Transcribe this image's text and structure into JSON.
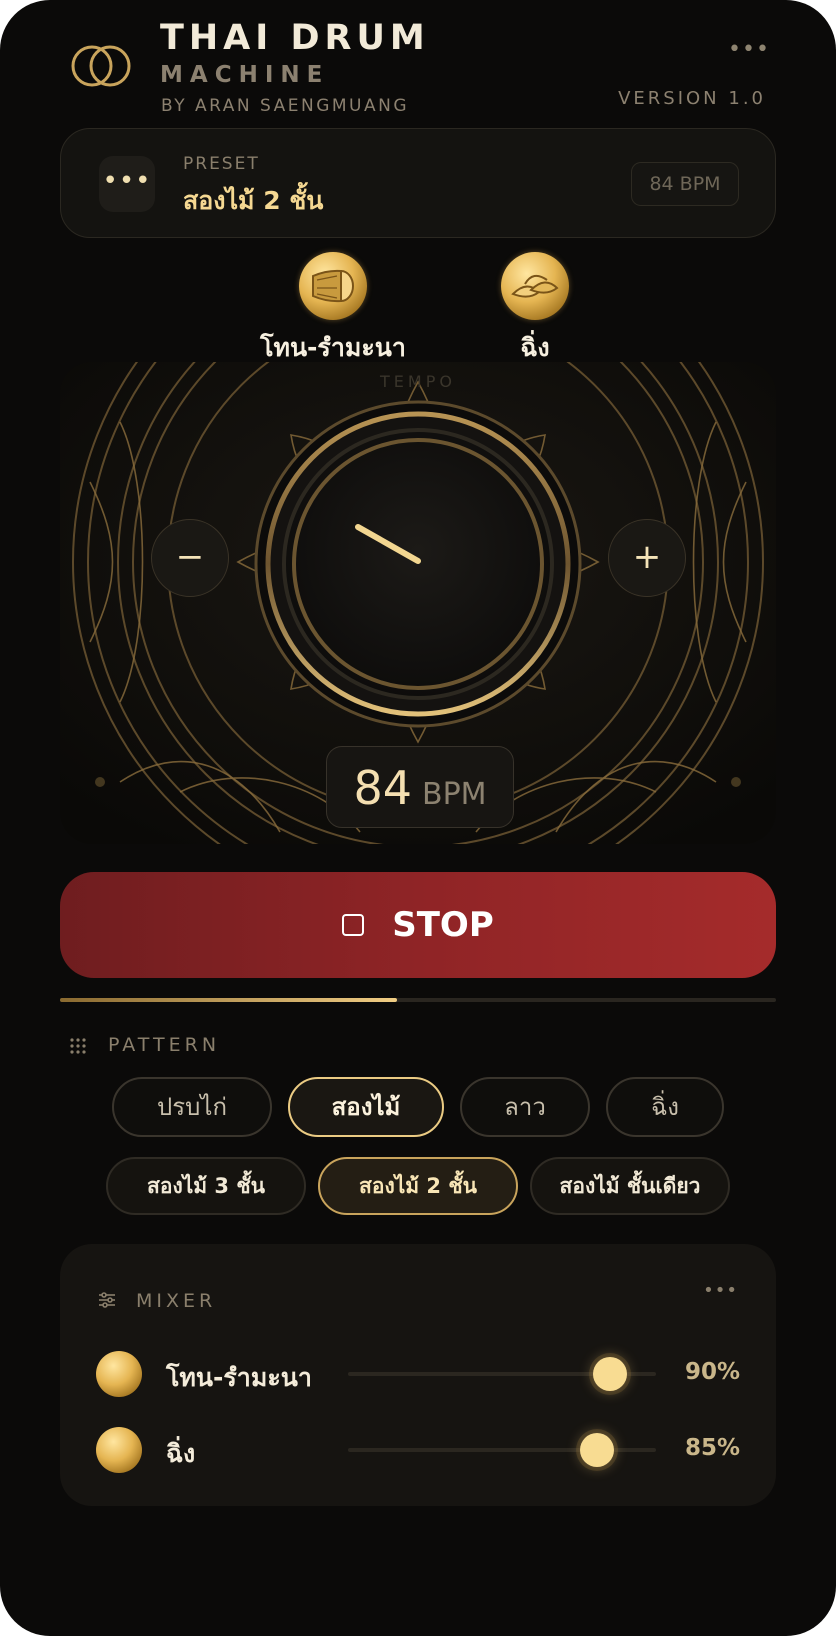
{
  "header": {
    "title_line1": "THAI DRUM",
    "title_line2": "MACHINE",
    "byline": "BY ARAN SAENGMUANG",
    "version": "VERSION 1.0",
    "more_icon": "more-horizontal-icon"
  },
  "preset": {
    "label": "PRESET",
    "name": "สองไม้ 2 ชั้น",
    "bpm_badge": "84 BPM",
    "menu_icon": "dots-icon"
  },
  "instruments": [
    {
      "name": "โทน-รำมะนา",
      "icon": "drum-icon"
    },
    {
      "name": "ฉิ่ง",
      "icon": "cymbal-icon"
    }
  ],
  "tempo": {
    "label": "TEMPO",
    "bpm_value": "84",
    "bpm_unit": "BPM",
    "decrease_label": "−",
    "increase_label": "+"
  },
  "transport": {
    "stop_label": "STOP",
    "progress": 0.47
  },
  "pattern": {
    "title": "PATTERN",
    "styles": [
      {
        "label": "ปรบไก่",
        "active": false
      },
      {
        "label": "สองไม้",
        "active": true
      },
      {
        "label": "ลาว",
        "active": false
      },
      {
        "label": "ฉิ่ง",
        "active": false
      }
    ],
    "variants": [
      {
        "label": "สองไม้ 3 ชั้น",
        "active": false
      },
      {
        "label": "สองไม้ 2 ชั้น",
        "active": true
      },
      {
        "label": "สองไม้ ชั้นเดียว",
        "active": false
      }
    ]
  },
  "mixer": {
    "title": "MIXER",
    "channels": [
      {
        "name": "โทน-รำมะนา",
        "volume_label": "90%",
        "volume": 0.85
      },
      {
        "name": "ฉิ่ง",
        "volume_label": "85%",
        "volume": 0.81
      }
    ]
  },
  "colors": {
    "background": "#0b0a09",
    "gold": "#f1cd84",
    "stop_red": "#9b2828"
  }
}
